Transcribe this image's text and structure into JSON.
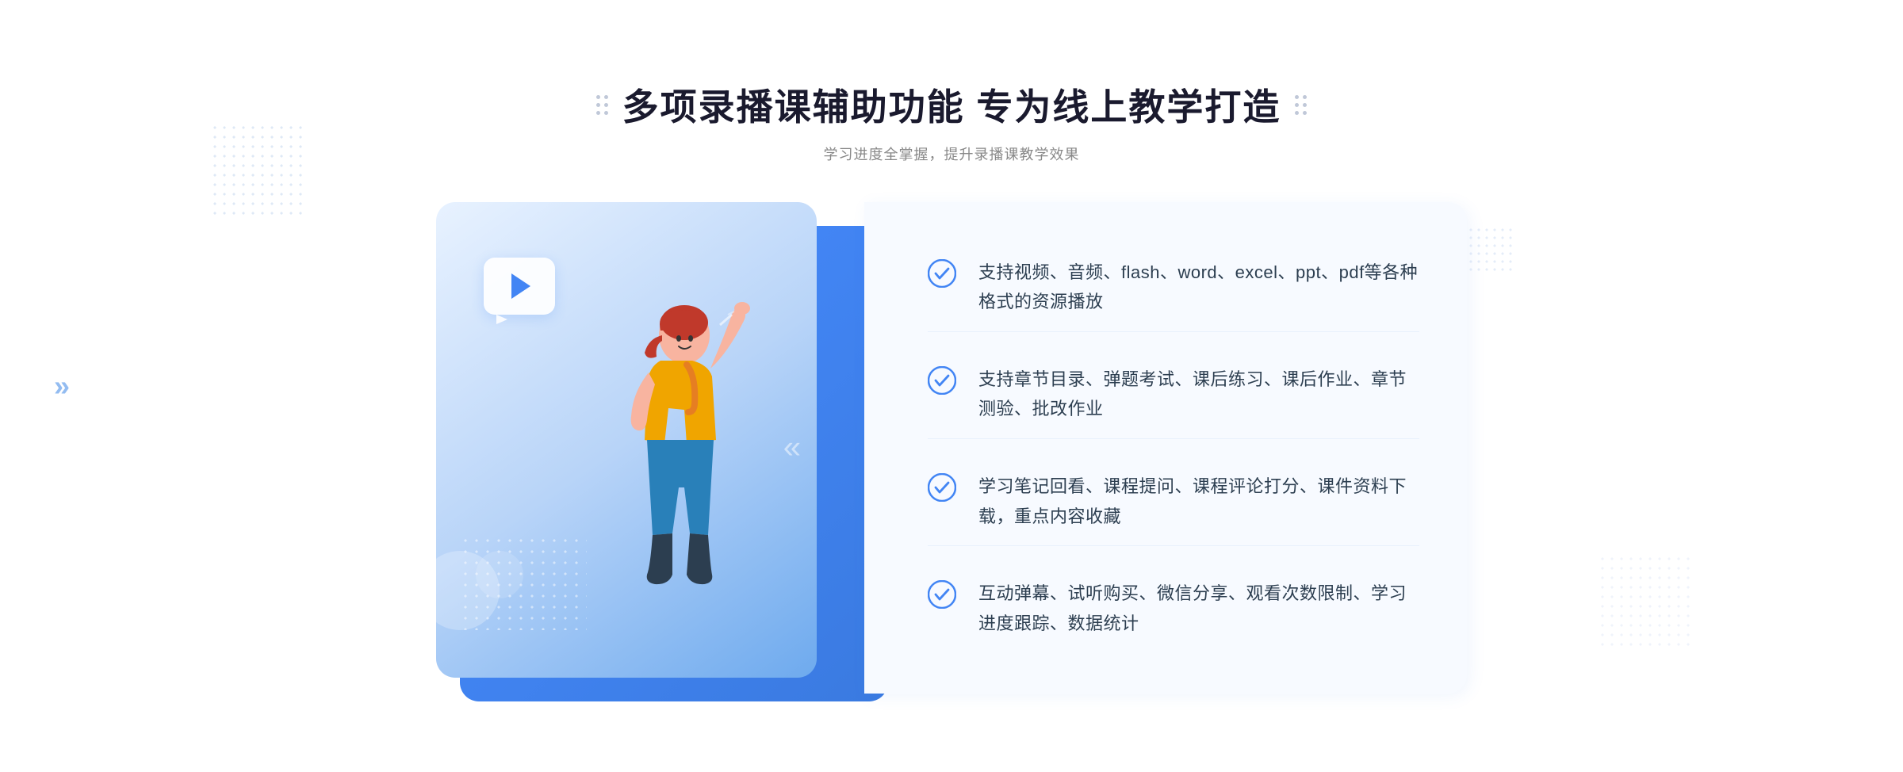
{
  "header": {
    "title": "多项录播课辅助功能 专为线上教学打造",
    "subtitle": "学习进度全掌握，提升录播课教学效果",
    "title_dots_decoration": "decorative-dots"
  },
  "features": [
    {
      "id": 1,
      "text": "支持视频、音频、flash、word、excel、ppt、pdf等各种格式的资源播放"
    },
    {
      "id": 2,
      "text": "支持章节目录、弹题考试、课后练习、课后作业、章节测验、批改作业"
    },
    {
      "id": 3,
      "text": "学习笔记回看、课程提问、课程评论打分、课件资料下载，重点内容收藏"
    },
    {
      "id": 4,
      "text": "互动弹幕、试听购买、微信分享、观看次数限制、学习进度跟踪、数据统计"
    }
  ],
  "illustration": {
    "play_button_label": "play",
    "accent_color": "#4285f4"
  },
  "decorations": {
    "chevron_left": "»"
  }
}
